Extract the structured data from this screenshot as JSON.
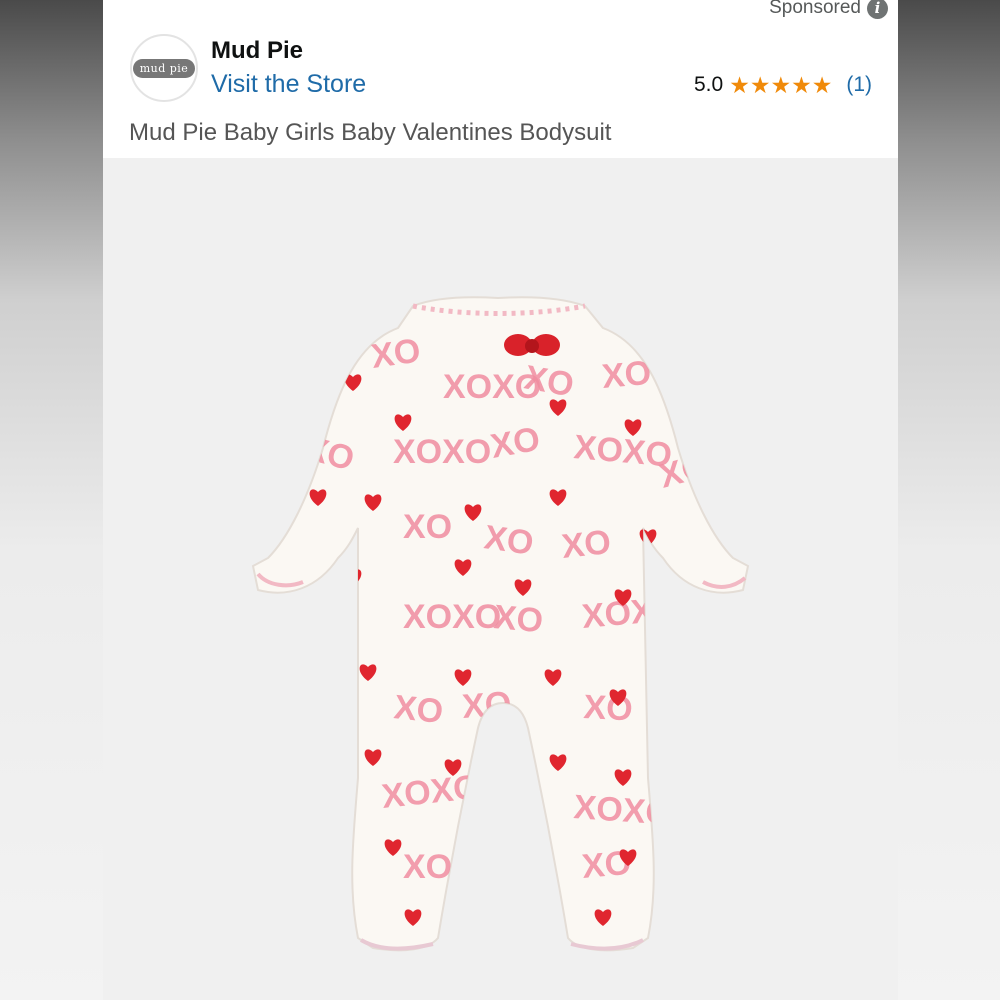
{
  "ad": {
    "sponsored_label": "Sponsored",
    "info_icon": "info-icon"
  },
  "brand": {
    "name": "Mud Pie",
    "logo_text": "mud pie",
    "visit_store": "Visit the Store"
  },
  "rating": {
    "score": "5.0",
    "stars": 5,
    "count": "(1)"
  },
  "product": {
    "title": "Mud Pie Baby Girls Baby Valentines Bodysuit",
    "print_text": "XO",
    "print_text_long": "XOXO"
  },
  "colors": {
    "link": "#1f6ba8",
    "star": "#f08a0a",
    "heart": "#e0262f",
    "print_pink": "#f08da0"
  }
}
